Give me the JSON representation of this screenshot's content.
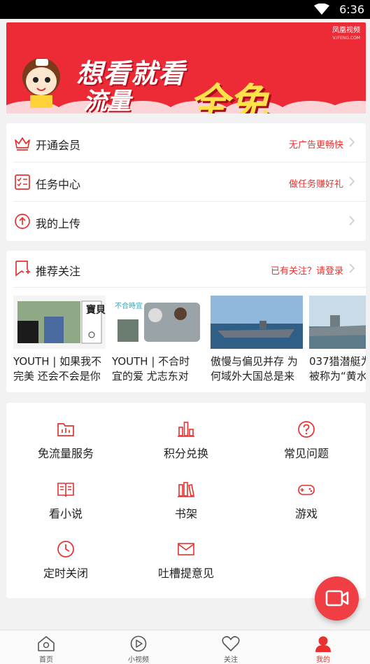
{
  "status_bar": {
    "time": "6:36"
  },
  "banner": {
    "brand": "凤凰视频",
    "brand_sub": "V.IFENG.COM",
    "line1": "想看就看",
    "line2a": "流量",
    "line2b": "全免"
  },
  "menu": {
    "items": [
      {
        "label": "开通会员",
        "hint": "无广告更畅快",
        "icon": "crown-icon"
      },
      {
        "label": "任务中心",
        "hint": "做任务赚好礼",
        "icon": "task-list-icon"
      },
      {
        "label": "我的上传",
        "hint": "",
        "icon": "upload-icon"
      }
    ]
  },
  "recommend": {
    "title": "推荐关注",
    "hint": "已有关注？请登录",
    "videos": [
      {
        "line1": "YOUTH | 如果我不",
        "line2": "完美 还会不会是你",
        "thumb_text": "寶貝"
      },
      {
        "line1": "YOUTH | 不合时",
        "line2": "宜的爱 尤志东对",
        "thumb_text": "不合時宜"
      },
      {
        "line1": "傲慢与偏见并存 为",
        "line2": "何域外大国总是来"
      },
      {
        "line1": "037猎潜艇为",
        "line2": "被称为“黄水"
      }
    ]
  },
  "services": [
    {
      "label": "免流量服务",
      "icon": "folder-icon"
    },
    {
      "label": "积分兑换",
      "icon": "points-chart-icon"
    },
    {
      "label": "常见问题",
      "icon": "question-icon"
    },
    {
      "label": "看小说",
      "icon": "book-icon"
    },
    {
      "label": "书架",
      "icon": "bookshelf-icon"
    },
    {
      "label": "游戏",
      "icon": "gamepad-icon"
    },
    {
      "label": "定时关闭",
      "icon": "clock-icon"
    },
    {
      "label": "吐槽提意见",
      "icon": "envelope-icon"
    }
  ],
  "tabs": [
    {
      "label": "首页",
      "icon": "home-icon"
    },
    {
      "label": "小视频",
      "icon": "play-icon"
    },
    {
      "label": "关注",
      "icon": "heart-icon"
    },
    {
      "label": "我的",
      "icon": "user-icon",
      "active": true
    }
  ],
  "colors": {
    "accent": "#e8312f",
    "banner": "#ec2b36",
    "highlight": "#ffe24a"
  }
}
